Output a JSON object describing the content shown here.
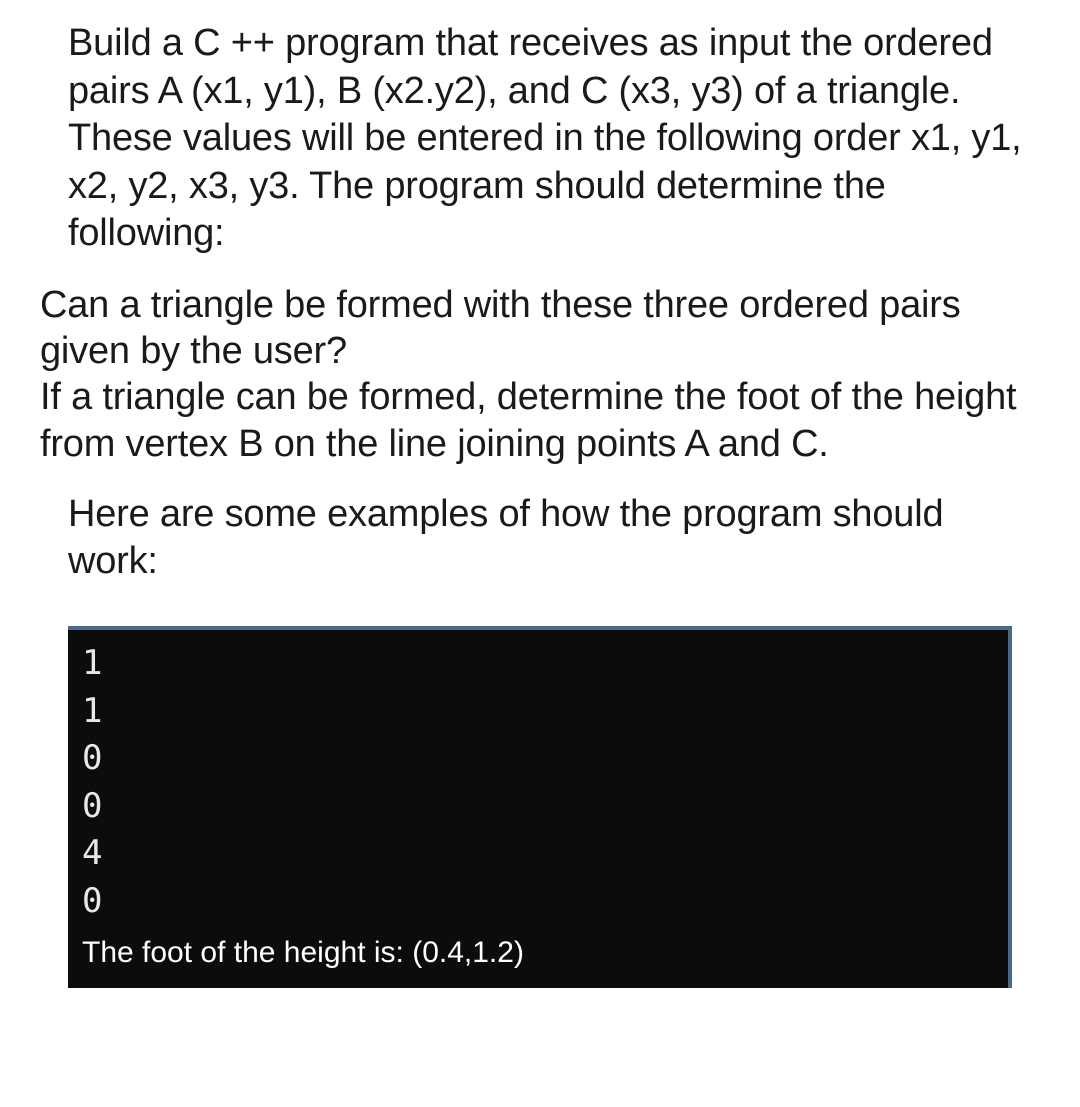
{
  "paragraphs": {
    "p1": "Build a C ++ program that receives as input the ordered pairs A (x1, y1), B (x2.y2), and C (x3, y3) of a triangle. These values will be entered in the following order x1, y1, x2, y2, x3, y3. The program should determine the following:",
    "p2": "Can a triangle be formed with these three ordered pairs given by the user?\nIf a triangle can be formed, determine the foot of the height from vertex B on the line joining points A and C.",
    "p3": "Here are some examples of how the program should work:"
  },
  "terminal": {
    "inputs": [
      "1",
      "1",
      "0",
      "0",
      "4",
      "0"
    ],
    "output": "The foot of the height is: (0.4,1.2)"
  }
}
